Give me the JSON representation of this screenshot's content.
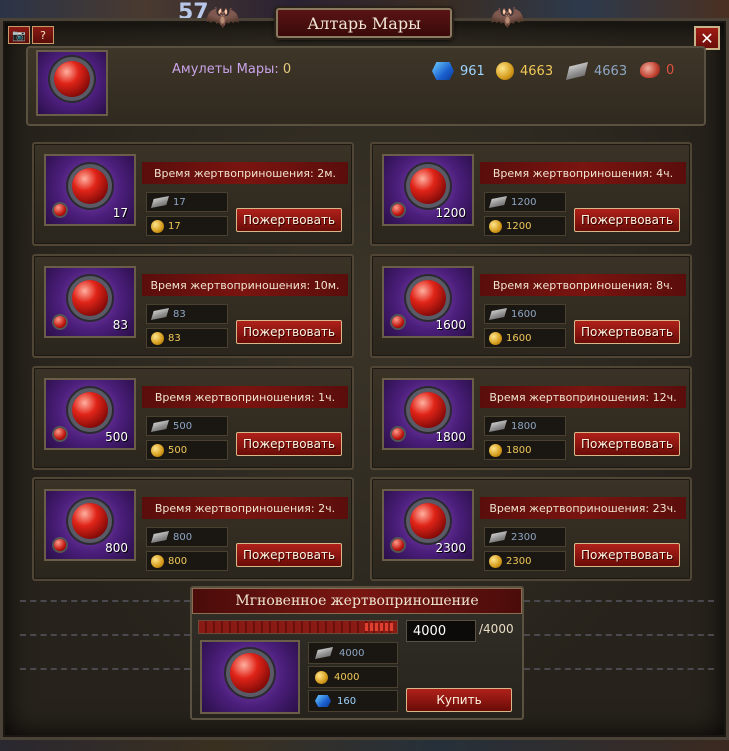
{
  "background": {
    "number": "57"
  },
  "window": {
    "title": "Алтарь Мары",
    "close_label": "✕",
    "screenshot_label": "📷",
    "help_label": "?"
  },
  "header": {
    "amulets_label": "Амулеты Мары:",
    "amulets_count": "0",
    "resources": {
      "gems": "961",
      "gold": "4663",
      "silver": "4663",
      "meat": "0"
    }
  },
  "sacrifice_button_label": "Пожертвовать",
  "cards": [
    {
      "time": "Время жертвоприношения: 2м.",
      "qty": "17",
      "silver": "17",
      "gold": "17"
    },
    {
      "time": "Время жертвоприношения: 4ч.",
      "qty": "1200",
      "silver": "1200",
      "gold": "1200"
    },
    {
      "time": "Время жертвоприношения: 10м.",
      "qty": "83",
      "silver": "83",
      "gold": "83"
    },
    {
      "time": "Время жертвоприношения: 8ч.",
      "qty": "1600",
      "silver": "1600",
      "gold": "1600"
    },
    {
      "time": "Время жертвоприношения: 1ч.",
      "qty": "500",
      "silver": "500",
      "gold": "500"
    },
    {
      "time": "Время жертвоприношения: 12ч.",
      "qty": "1800",
      "silver": "1800",
      "gold": "1800"
    },
    {
      "time": "Время жертвоприношения: 2ч.",
      "qty": "800",
      "silver": "800",
      "gold": "800"
    },
    {
      "time": "Время жертвоприношения: 23ч.",
      "qty": "2300",
      "silver": "2300",
      "gold": "2300"
    }
  ],
  "instant": {
    "title": "Мгновенное жертвоприношение",
    "quantity": "4000",
    "max": "/4000",
    "progress_fraction": 1.0,
    "silver": "4000",
    "gold": "4000",
    "gems": "160",
    "buy_label": "Купить"
  }
}
